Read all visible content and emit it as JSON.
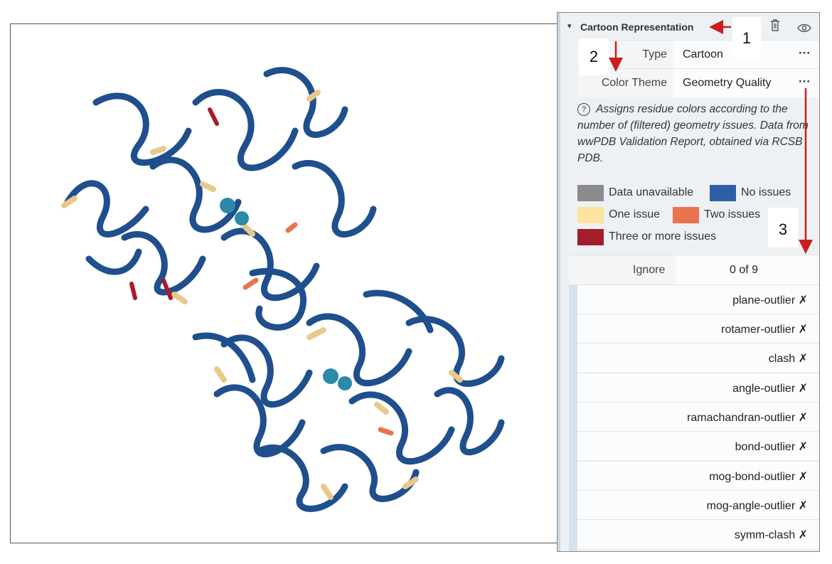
{
  "panel": {
    "title": "Cartoon Representation",
    "caret_icon": "chevron-down-icon",
    "delete_icon": "trash-icon",
    "visibility_icon": "eye-icon",
    "type_label": "Type",
    "type_value": "Cartoon",
    "color_theme_label": "Color Theme",
    "color_theme_value": "Geometry Quality",
    "more_icon": "ellipsis-icon",
    "help_icon": "question-circle-icon",
    "description": "Assigns residue colors according to the number of (filtered) geometry issues. Data from wwPDB Validation Report, obtained via RCSB PDB.",
    "legend": [
      {
        "label": "Data unavailable",
        "color": "#8c8c8c"
      },
      {
        "label": "No issues",
        "color": "#2e5fa6"
      },
      {
        "label": "One issue",
        "color": "#fce3a0"
      },
      {
        "label": "Two issues",
        "color": "#e8734f"
      },
      {
        "label": "Three or more issues",
        "color": "#a51d2d"
      }
    ],
    "ignore_label": "Ignore",
    "ignore_value": "0 of 9",
    "ignore_items": [
      "plane-outlier ✗",
      "rotamer-outlier ✗",
      "clash ✗",
      "angle-outlier ✗",
      "ramachandran-outlier ✗",
      "bond-outlier ✗",
      "mog-bond-outlier ✗",
      "mog-angle-outlier ✗",
      "symm-clash ✗"
    ]
  },
  "annotations": [
    "1",
    "2",
    "3"
  ],
  "colors": {
    "arrow": "#c8201c",
    "protein": "#1f4f8c",
    "highlight": "#e8c98a"
  }
}
